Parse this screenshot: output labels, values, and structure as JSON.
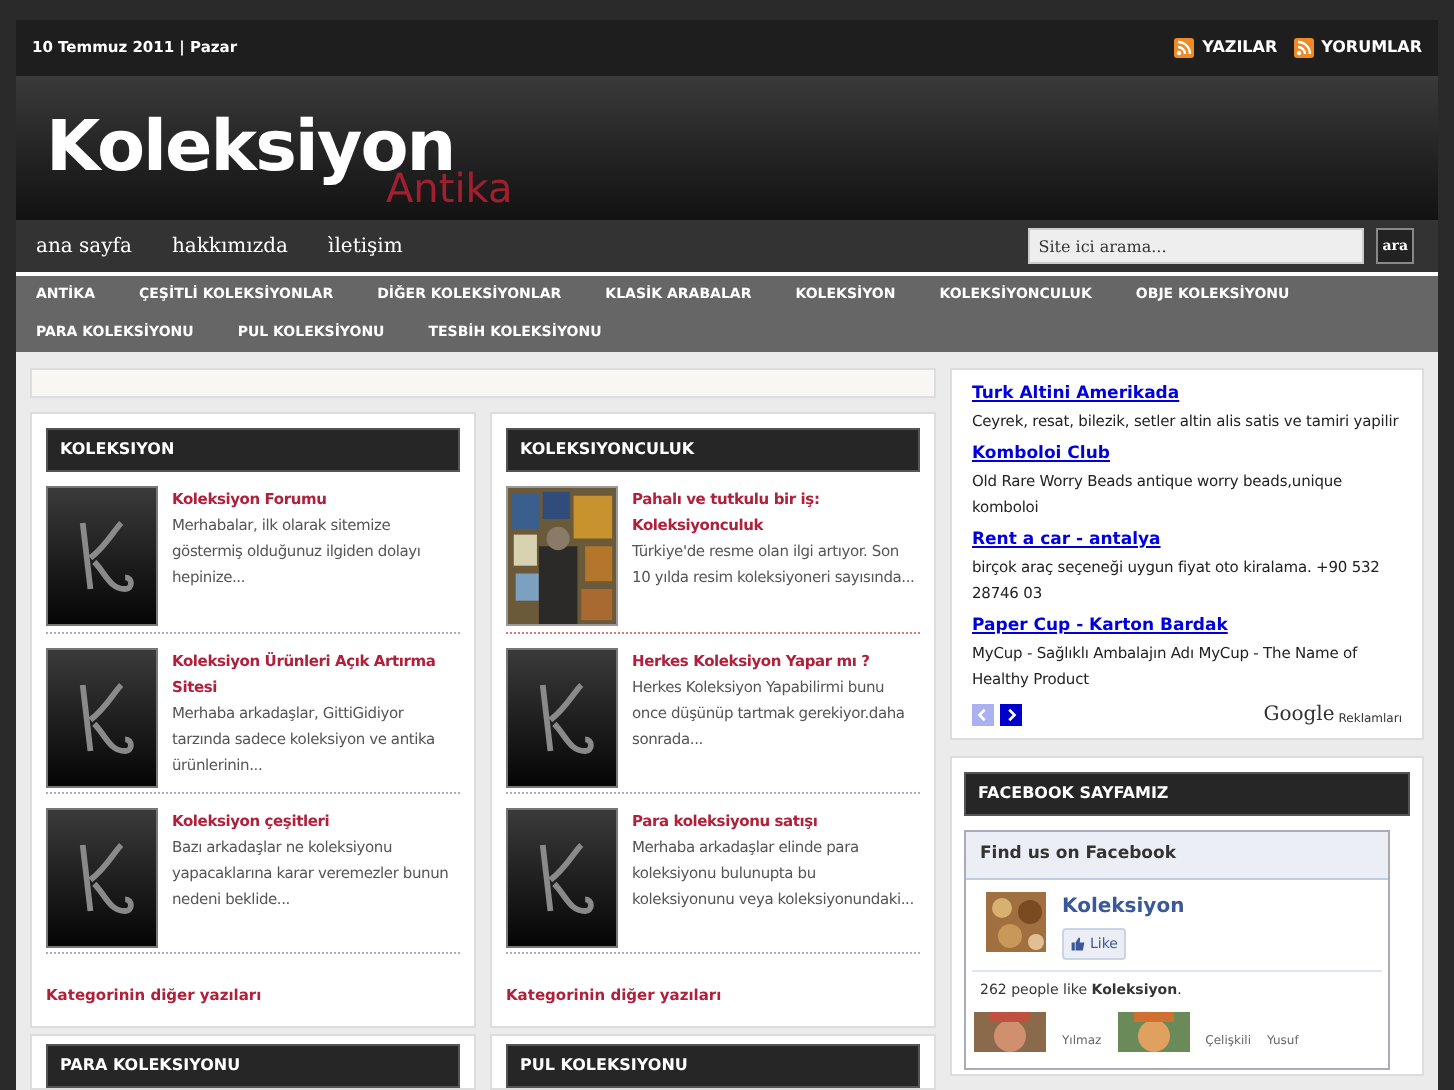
{
  "top_bar": {
    "date": "10 Temmuz 2011 | Pazar",
    "feeds": [
      "YAZILAR",
      "YORUMLAR"
    ]
  },
  "logo": {
    "title": "Koleksiyon",
    "subtitle": "Antika"
  },
  "nav": {
    "links": [
      "ana sayfa",
      "hakkımızda",
      "ìletişim"
    ],
    "search": {
      "placeholder": "Site ici arama..."
    },
    "search_button": "ara"
  },
  "categories": [
    "ANTİKA",
    "ÇEŞİTLİ KOLEKSİYONLAR",
    "DİĞER KOLEKSİYONLAR",
    "KLASİK ARABALAR",
    "KOLEKSİYON",
    "KOLEKSİYONCULUK",
    "OBJE KOLEKSİYONU",
    "PARA KOLEKSİYONU",
    "PUL KOLEKSİYONU",
    "TESBİH KOLEKSİYONU"
  ],
  "sections": [
    {
      "title": "KOLEKSIYON",
      "posts": [
        {
          "title": "Koleksiyon Forumu",
          "excerpt": "Merhabalar, ilk olarak sitemize göstermiş olduğunuz ilgiden dolayı hepinize..."
        },
        {
          "title": "Koleksiyon Ürünleri Açık Artırma Sitesi",
          "excerpt": "Merhaba arkadaşlar, GittiGidiyor tarzında sadece koleksiyon ve antika ürünlerinin..."
        },
        {
          "title": "Koleksiyon çeşitleri",
          "excerpt": "Bazı arkadaşlar ne koleksiyonu yapacaklarına karar veremezler bunun nedeni beklide..."
        }
      ],
      "more": "Kategorinin diğer yazıları"
    },
    {
      "title": "KOLEKSIYONCULUK",
      "posts": [
        {
          "title": "Pahalı ve tutkulu bir iş: Koleksiyonculuk",
          "excerpt": "Türkiye'de resme olan ilgi artıyor. Son 10 yılda resim koleksiyoneri sayısında..."
        },
        {
          "title": "Herkes Koleksiyon Yapar mı ?",
          "excerpt": "Herkes Koleksiyon Yapabilirmi bunu once düşünüp tartmak gerekiyor.daha sonrada..."
        },
        {
          "title": "Para koleksiyonu satışı",
          "excerpt": "Merhaba arkadaşlar elinde para koleksiyonu bulunupta bu koleksiyonunu veya koleksiyonundaki..."
        }
      ],
      "more": "Kategorinin diğer yazıları"
    }
  ],
  "next_sections": [
    "PARA KOLEKSIYONU",
    "PUL KOLEKSIYONU"
  ],
  "ads": {
    "items": [
      {
        "title": "Turk Altini Amerikada",
        "text": "Ceyrek, resat, bilezik, setler altin alis satis ve tamiri yapilir"
      },
      {
        "title": "Komboloi Club",
        "text": "Old Rare Worry Beads antique worry beads,unique komboloi"
      },
      {
        "title": "Rent a car - antalya",
        "text": "birçok araç seçeneği uygun fiyat oto kiralama. +90 532 28746 03"
      },
      {
        "title": "Paper Cup - Karton Bardak",
        "text": "MyCup - Sağlıklı Ambalajın Adı MyCup - The Name of Healthy Product"
      }
    ],
    "prev_disabled": true,
    "brand": "Google",
    "label": "Reklamları"
  },
  "facebook": {
    "heading": "FACEBOOK SAYFAMIZ",
    "title": "Find us on Facebook",
    "page": "Koleksiyon",
    "like": "Like",
    "count": "262 people like **Koleksiyon**.",
    "fans": [
      "Yılmaz",
      "Çelişkili",
      "Yusuf"
    ]
  }
}
